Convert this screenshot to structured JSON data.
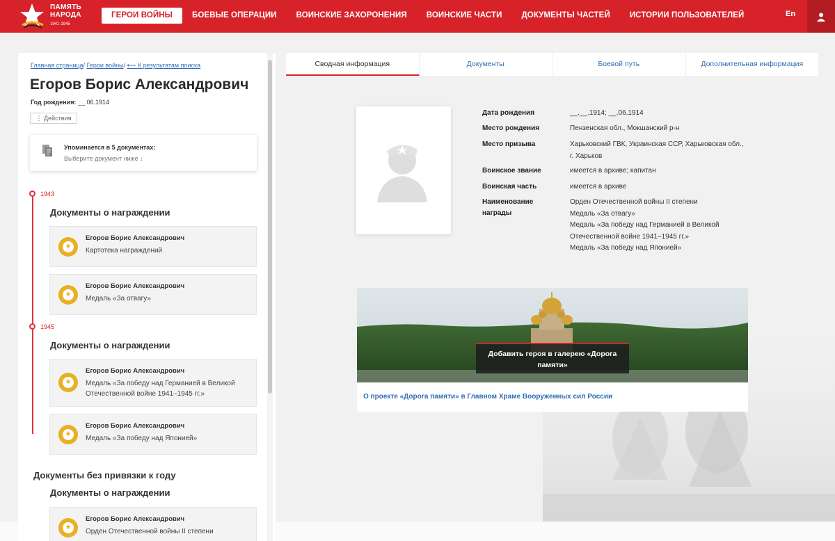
{
  "header": {
    "logo_line1": "ПАМЯТЬ",
    "logo_line2": "НАРОДА",
    "logo_years": "1941-1945",
    "nav": [
      {
        "label": "ГЕРОИ ВОЙНЫ",
        "active": true
      },
      {
        "label": "БОЕВЫЕ ОПЕРАЦИИ"
      },
      {
        "label": "ВОИНСКИЕ ЗАХОРОНЕНИЯ"
      },
      {
        "label": "ВОИНСКИЕ ЧАСТИ"
      },
      {
        "label": "ДОКУМЕНТЫ ЧАСТЕЙ"
      },
      {
        "label": "ИСТОРИИ ПОЛЬЗОВАТЕЛЕЙ"
      }
    ],
    "lang": "En",
    "user_icon": "user-icon"
  },
  "breadcrumbs": {
    "home": "Главная страница",
    "heroes": "Герои войны",
    "back": "⟵ К результатам поиска"
  },
  "hero": {
    "name": "Егоров Борис Александрович",
    "birth_label": "Год рождения:",
    "birth_value": "__.06.1914",
    "actions_label": "⋮ Действия"
  },
  "mentions": {
    "title": "Упоминается в 5 документах:",
    "subtitle": "Выберите документ ниже ↓"
  },
  "timeline": [
    {
      "year": "1943",
      "section": "Документы о награждении",
      "docs": [
        {
          "name": "Егоров Борис Александрович",
          "desc": "Картотека награждений"
        },
        {
          "name": "Егоров Борис Александрович",
          "desc": "Медаль «За отвагу»"
        }
      ]
    },
    {
      "year": "1945",
      "section": "Документы о награждении",
      "docs": [
        {
          "name": "Егоров Борис Александрович",
          "desc": "Медаль «За победу над Германией в Великой Отечественной войне 1941–1945 гг.»"
        },
        {
          "name": "Егоров Борис Александрович",
          "desc": "Медаль «За победу над Японией»"
        }
      ]
    }
  ],
  "no_year": {
    "title": "Документы без привязки к году",
    "section": "Документы о награждении",
    "docs": [
      {
        "name": "Егоров Борис Александрович",
        "desc": "Орден Отечественной войны II степени"
      }
    ]
  },
  "tabs": [
    {
      "label": "Сводная информация",
      "active": true
    },
    {
      "label": "Документы"
    },
    {
      "label": "Боевой путь"
    },
    {
      "label": "Дополнительная информация"
    }
  ],
  "info": [
    {
      "label": "Дата рождения",
      "value": "__.__.1914; __.06.1914"
    },
    {
      "label": "Место рождения",
      "value": "Пензенская обл., Мокшанский р-н"
    },
    {
      "label": "Место призыва",
      "value": "Харьковский ГВК, Украинская ССР, Харьковская обл., г. Харьков"
    },
    {
      "label": "Воинское звание",
      "value": "имеется в архиве; капитан"
    },
    {
      "label": "Воинская часть",
      "value": "имеется в архиве"
    },
    {
      "label": "Наименование награды",
      "value": "Орден Отечественной войны II степени\nМедаль «За отвагу»\nМедаль «За победу над Германией в Великой Отечественной войне 1941–1945 гг.»\nМедаль «За победу над Японией»"
    }
  ],
  "gallery": {
    "button": "Добавить героя в галерею «Дорога памяти»",
    "link": "О проекте «Дорога памяти» в Главном Храме Вооруженных сил России"
  },
  "colors": {
    "brand_red": "#d8222a",
    "link_blue": "#2d6fb4",
    "medal_gold": "#e8b022"
  }
}
